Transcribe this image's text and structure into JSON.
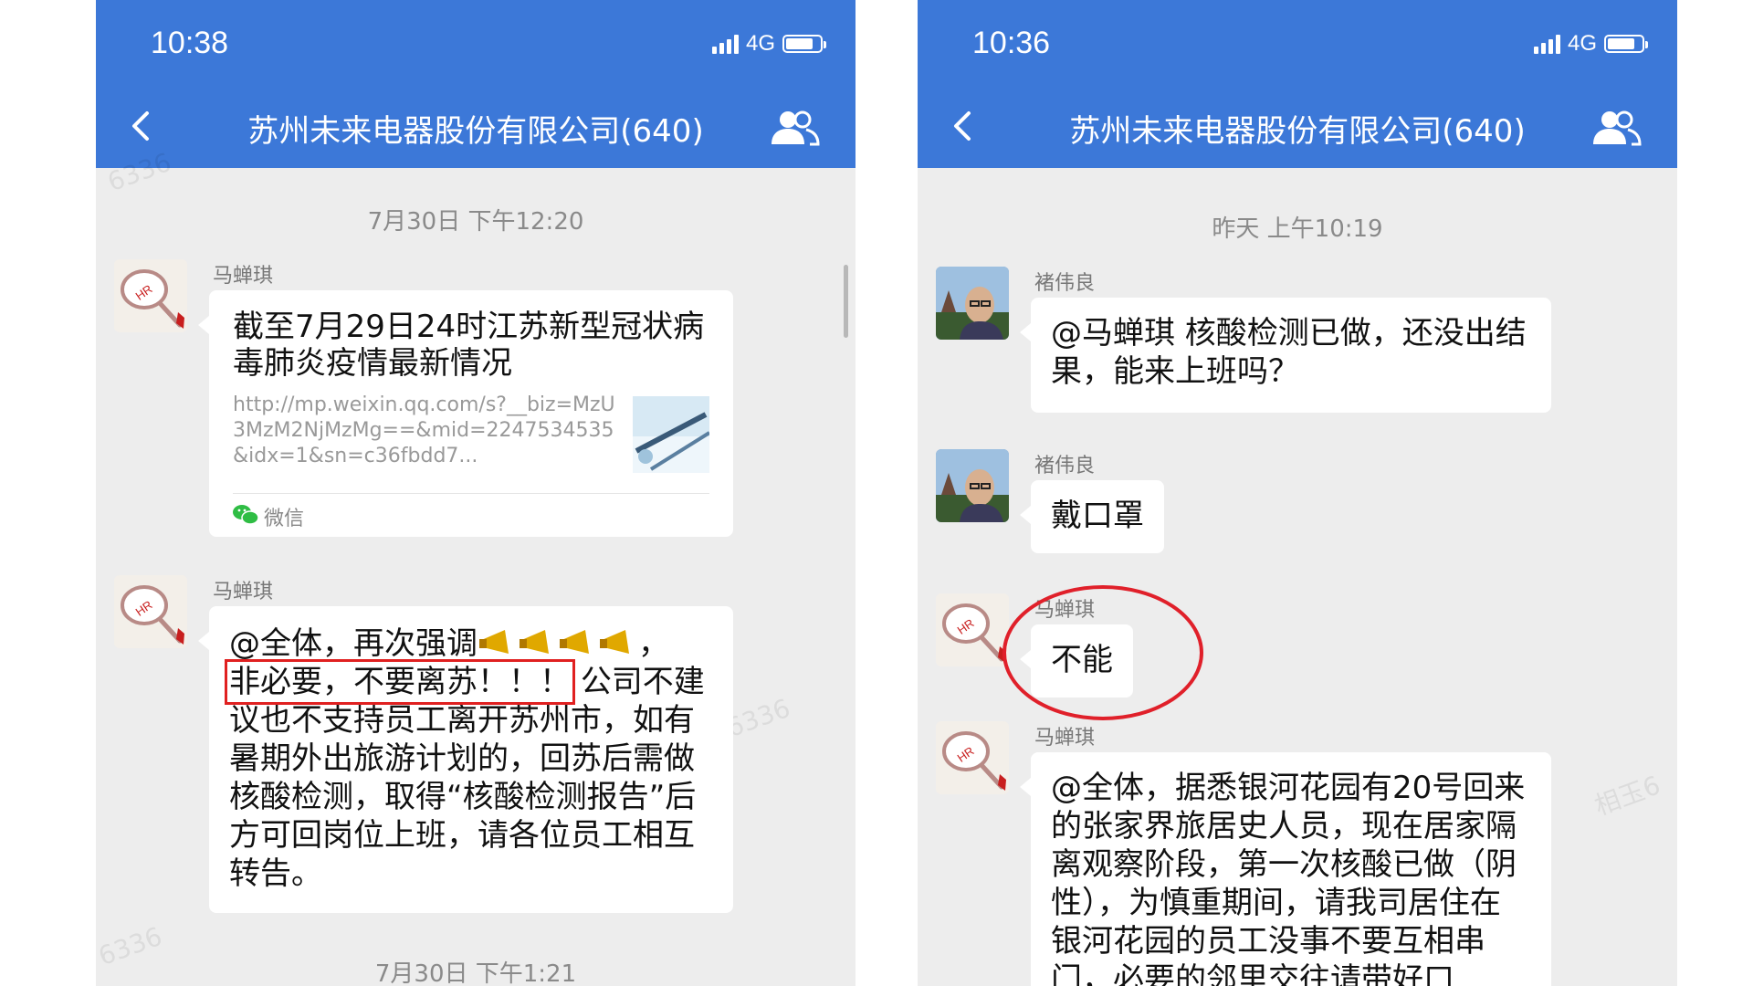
{
  "left": {
    "status": {
      "time": "10:38",
      "network": "4G"
    },
    "chat_title": "苏州未来电器股份有限公司(640)",
    "timestamps": [
      "7月30日 下午12:20",
      "7月30日 下午1:21"
    ],
    "messages": [
      {
        "sender": "马蝉琪",
        "card_title": "截至7月29日24时江苏新型冠状病毒肺炎疫情最新情况",
        "card_url": "http://mp.weixin.qq.com/s?__biz=MzU3MzM2NjMzMg==&mid=2247534535&idx=1&sn=c36fbdd7...",
        "card_source": "微信"
      },
      {
        "sender": "马蝉琪",
        "text_prefix": "@全体，再次强调",
        "text_suffix": "，",
        "highlight": "非必要，不要离苏！！！",
        "text_rest": "公司不建议也不支持员工离开苏州市，如有暑期外出旅游计划的，回苏后需做核酸检测，取得“核酸检测报告”后方可回岗位上班，请各位员工相互转告。"
      }
    ],
    "watermark": "6336"
  },
  "right": {
    "status": {
      "time": "10:36",
      "network": "4G"
    },
    "chat_title": "苏州未来电器股份有限公司(640)",
    "timestamp": "昨天 上午10:19",
    "messages": [
      {
        "sender": "褚伟良",
        "text": "@马蝉琪 核酸检测已做，还没出结果，能来上班吗？"
      },
      {
        "sender": "褚伟良",
        "text": "戴口罩"
      },
      {
        "sender": "马蝉琪",
        "text": "不能"
      },
      {
        "sender": "马蝉琪",
        "text": "@全体，据悉银河花园有20号回来的张家界旅居史人员，现在居家隔离观察阶段，第一次核酸已做（阴性），为慎重期间，请我司居住在银河花园的员工没事不要互相串门，必要的邻里交往请带好口"
      }
    ],
    "watermark": "相玉6"
  },
  "colors": {
    "header": "#3c78d8",
    "chat_bg": "#ededed",
    "highlight_box": "#e02020",
    "circle": "#e0202a"
  },
  "icons": [
    "back-chevron-icon",
    "group-members-icon",
    "signal-icon",
    "battery-icon",
    "wechat-icon",
    "megaphone-icon"
  ]
}
